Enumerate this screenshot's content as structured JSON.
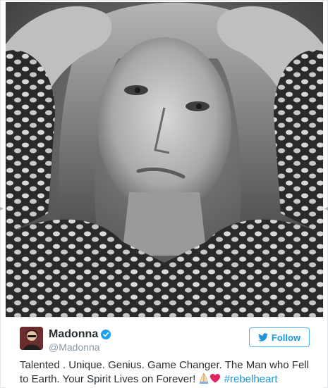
{
  "photo": {
    "description_icon": "portrait-photo"
  },
  "tweet": {
    "user": {
      "name": "Madonna",
      "handle": "@Madonna",
      "verified": true,
      "avatar_icon": "avatar-image"
    },
    "follow_label": "Follow",
    "text_main": "Talented . Unique. Genius. Game Changer. The Man who Fell to Earth. Your Spirit Lives on Forever!",
    "emoji_icons": [
      "praying-hands-icon",
      "red-heart-icon"
    ],
    "hashtag": "#rebelheart"
  },
  "colors": {
    "accent": "#1b95e0",
    "follow_border": "#55acee",
    "handle": "#8899a6",
    "text": "#292f33",
    "heart": "#e0245e"
  }
}
